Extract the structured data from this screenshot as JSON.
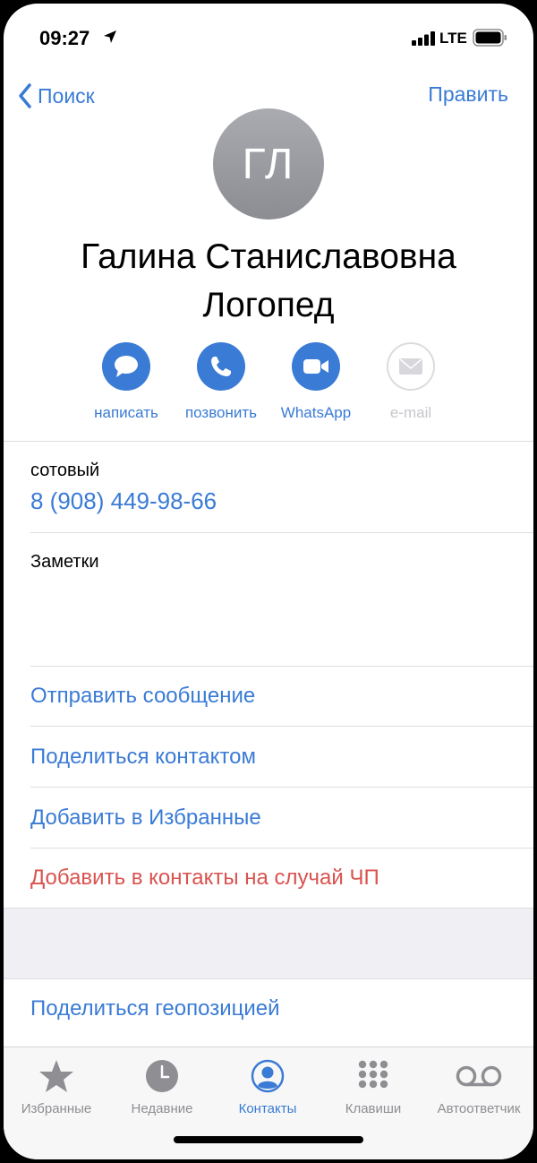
{
  "status": {
    "time": "09:27",
    "network": "LTE"
  },
  "nav": {
    "back_label": "Поиск",
    "edit_label": "Править"
  },
  "contact": {
    "initials": "ГЛ",
    "name_line1": "Галина Станиславовна",
    "name_line2": "Логопед"
  },
  "actions": [
    {
      "label": "написать",
      "icon": "message-icon",
      "enabled": true
    },
    {
      "label": "позвонить",
      "icon": "phone-icon",
      "enabled": true
    },
    {
      "label": "WhatsApp",
      "icon": "video-icon",
      "enabled": true
    },
    {
      "label": "e-mail",
      "icon": "mail-icon",
      "enabled": false
    }
  ],
  "phone": {
    "label": "сотовый",
    "number": "8 (908) 449-98-66"
  },
  "notes": {
    "label": "Заметки"
  },
  "links": {
    "send_message": "Отправить сообщение",
    "share_contact": "Поделиться контактом",
    "add_favorites": "Добавить в Избранные",
    "add_emergency": "Добавить в контакты на случай ЧП",
    "share_location": "Поделиться геопозицией"
  },
  "tabs": [
    {
      "label": "Избранные",
      "icon": "star-icon",
      "active": false
    },
    {
      "label": "Недавние",
      "icon": "clock-icon",
      "active": false
    },
    {
      "label": "Контакты",
      "icon": "person-icon",
      "active": true
    },
    {
      "label": "Клавиши",
      "icon": "keypad-icon",
      "active": false
    },
    {
      "label": "Автоответчик",
      "icon": "voicemail-icon",
      "active": false
    }
  ],
  "colors": {
    "accent": "#3a7bd5",
    "danger": "#d9534f",
    "inactive": "#8e8e93"
  }
}
